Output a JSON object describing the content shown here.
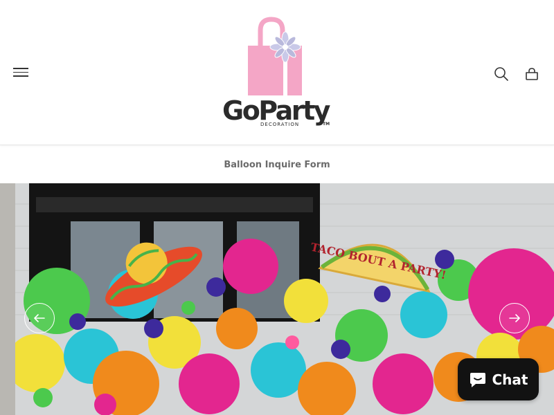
{
  "header": {
    "logo": {
      "name": "GoParty",
      "subtitle": "DECORATION",
      "trademark": "TM",
      "bag_color": "#f4a6c6",
      "ribbon_color": "#c7c7e6"
    },
    "menu_icon": "hamburger-menu-icon",
    "search_icon": "search-icon",
    "cart_icon": "cart-icon"
  },
  "nav": {
    "items": [
      {
        "label": "Balloon Inquire Form"
      }
    ]
  },
  "hero": {
    "slide_description": "Colorful balloon garland with sombrero and taco foil balloons",
    "foil_balloon_text": "TACO BOUT A PARTY!",
    "prev_icon": "arrow-left-icon",
    "next_icon": "arrow-right-icon"
  },
  "chat": {
    "label": "Chat",
    "icon": "chat-bubble-icon"
  },
  "colors": {
    "nav_text": "#6b6b6b",
    "logo_text": "#2b2b2b",
    "chat_bg": "#121212"
  }
}
